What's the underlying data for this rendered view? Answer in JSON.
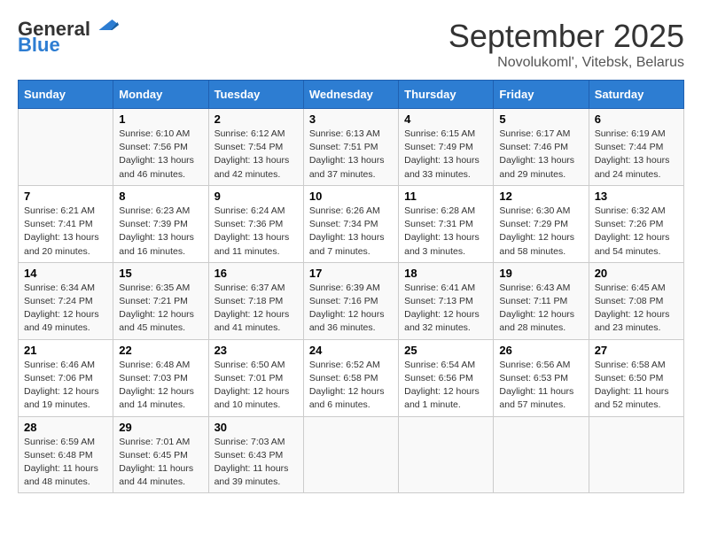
{
  "header": {
    "logo_line1": "General",
    "logo_line2": "Blue",
    "main_title": "September 2025",
    "subtitle": "Novolukoml', Vitebsk, Belarus"
  },
  "days_of_week": [
    "Sunday",
    "Monday",
    "Tuesday",
    "Wednesday",
    "Thursday",
    "Friday",
    "Saturday"
  ],
  "weeks": [
    [
      {
        "num": "",
        "info": ""
      },
      {
        "num": "1",
        "info": "Sunrise: 6:10 AM\nSunset: 7:56 PM\nDaylight: 13 hours\nand 46 minutes."
      },
      {
        "num": "2",
        "info": "Sunrise: 6:12 AM\nSunset: 7:54 PM\nDaylight: 13 hours\nand 42 minutes."
      },
      {
        "num": "3",
        "info": "Sunrise: 6:13 AM\nSunset: 7:51 PM\nDaylight: 13 hours\nand 37 minutes."
      },
      {
        "num": "4",
        "info": "Sunrise: 6:15 AM\nSunset: 7:49 PM\nDaylight: 13 hours\nand 33 minutes."
      },
      {
        "num": "5",
        "info": "Sunrise: 6:17 AM\nSunset: 7:46 PM\nDaylight: 13 hours\nand 29 minutes."
      },
      {
        "num": "6",
        "info": "Sunrise: 6:19 AM\nSunset: 7:44 PM\nDaylight: 13 hours\nand 24 minutes."
      }
    ],
    [
      {
        "num": "7",
        "info": "Sunrise: 6:21 AM\nSunset: 7:41 PM\nDaylight: 13 hours\nand 20 minutes."
      },
      {
        "num": "8",
        "info": "Sunrise: 6:23 AM\nSunset: 7:39 PM\nDaylight: 13 hours\nand 16 minutes."
      },
      {
        "num": "9",
        "info": "Sunrise: 6:24 AM\nSunset: 7:36 PM\nDaylight: 13 hours\nand 11 minutes."
      },
      {
        "num": "10",
        "info": "Sunrise: 6:26 AM\nSunset: 7:34 PM\nDaylight: 13 hours\nand 7 minutes."
      },
      {
        "num": "11",
        "info": "Sunrise: 6:28 AM\nSunset: 7:31 PM\nDaylight: 13 hours\nand 3 minutes."
      },
      {
        "num": "12",
        "info": "Sunrise: 6:30 AM\nSunset: 7:29 PM\nDaylight: 12 hours\nand 58 minutes."
      },
      {
        "num": "13",
        "info": "Sunrise: 6:32 AM\nSunset: 7:26 PM\nDaylight: 12 hours\nand 54 minutes."
      }
    ],
    [
      {
        "num": "14",
        "info": "Sunrise: 6:34 AM\nSunset: 7:24 PM\nDaylight: 12 hours\nand 49 minutes."
      },
      {
        "num": "15",
        "info": "Sunrise: 6:35 AM\nSunset: 7:21 PM\nDaylight: 12 hours\nand 45 minutes."
      },
      {
        "num": "16",
        "info": "Sunrise: 6:37 AM\nSunset: 7:18 PM\nDaylight: 12 hours\nand 41 minutes."
      },
      {
        "num": "17",
        "info": "Sunrise: 6:39 AM\nSunset: 7:16 PM\nDaylight: 12 hours\nand 36 minutes."
      },
      {
        "num": "18",
        "info": "Sunrise: 6:41 AM\nSunset: 7:13 PM\nDaylight: 12 hours\nand 32 minutes."
      },
      {
        "num": "19",
        "info": "Sunrise: 6:43 AM\nSunset: 7:11 PM\nDaylight: 12 hours\nand 28 minutes."
      },
      {
        "num": "20",
        "info": "Sunrise: 6:45 AM\nSunset: 7:08 PM\nDaylight: 12 hours\nand 23 minutes."
      }
    ],
    [
      {
        "num": "21",
        "info": "Sunrise: 6:46 AM\nSunset: 7:06 PM\nDaylight: 12 hours\nand 19 minutes."
      },
      {
        "num": "22",
        "info": "Sunrise: 6:48 AM\nSunset: 7:03 PM\nDaylight: 12 hours\nand 14 minutes."
      },
      {
        "num": "23",
        "info": "Sunrise: 6:50 AM\nSunset: 7:01 PM\nDaylight: 12 hours\nand 10 minutes."
      },
      {
        "num": "24",
        "info": "Sunrise: 6:52 AM\nSunset: 6:58 PM\nDaylight: 12 hours\nand 6 minutes."
      },
      {
        "num": "25",
        "info": "Sunrise: 6:54 AM\nSunset: 6:56 PM\nDaylight: 12 hours\nand 1 minute."
      },
      {
        "num": "26",
        "info": "Sunrise: 6:56 AM\nSunset: 6:53 PM\nDaylight: 11 hours\nand 57 minutes."
      },
      {
        "num": "27",
        "info": "Sunrise: 6:58 AM\nSunset: 6:50 PM\nDaylight: 11 hours\nand 52 minutes."
      }
    ],
    [
      {
        "num": "28",
        "info": "Sunrise: 6:59 AM\nSunset: 6:48 PM\nDaylight: 11 hours\nand 48 minutes."
      },
      {
        "num": "29",
        "info": "Sunrise: 7:01 AM\nSunset: 6:45 PM\nDaylight: 11 hours\nand 44 minutes."
      },
      {
        "num": "30",
        "info": "Sunrise: 7:03 AM\nSunset: 6:43 PM\nDaylight: 11 hours\nand 39 minutes."
      },
      {
        "num": "",
        "info": ""
      },
      {
        "num": "",
        "info": ""
      },
      {
        "num": "",
        "info": ""
      },
      {
        "num": "",
        "info": ""
      }
    ]
  ]
}
